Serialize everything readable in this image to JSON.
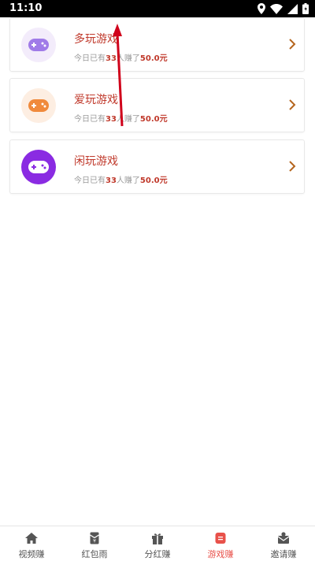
{
  "status_bar": {
    "time": "11:10"
  },
  "games": [
    {
      "title": "多玩游戏",
      "sub_prefix": "今日已有",
      "count": "33",
      "sub_mid": "人赚了",
      "amount": "50.0元",
      "icon": "gamepad-icon",
      "color": "#a07be8"
    },
    {
      "title": "爱玩游戏",
      "sub_prefix": "今日已有",
      "count": "33",
      "sub_mid": "人赚了",
      "amount": "50.0元",
      "icon": "gamepad-icon",
      "color": "#f08a3c"
    },
    {
      "title": "闲玩游戏",
      "sub_prefix": "今日已有",
      "count": "33",
      "sub_mid": "人赚了",
      "amount": "50.0元",
      "icon": "gamepad-icon",
      "color": "#8a2be2"
    }
  ],
  "tabs": [
    {
      "label": "视频赚",
      "icon": "home-icon"
    },
    {
      "label": "红包雨",
      "icon": "red-packet-icon"
    },
    {
      "label": "分红赚",
      "icon": "gift-icon"
    },
    {
      "label": "游戏赚",
      "icon": "game-tab-icon",
      "active": true
    },
    {
      "label": "邀请赚",
      "icon": "invite-icon"
    }
  ],
  "colors": {
    "accent": "#c0392b",
    "active_tab": "#e8514a",
    "chevron": "#b5651d"
  }
}
